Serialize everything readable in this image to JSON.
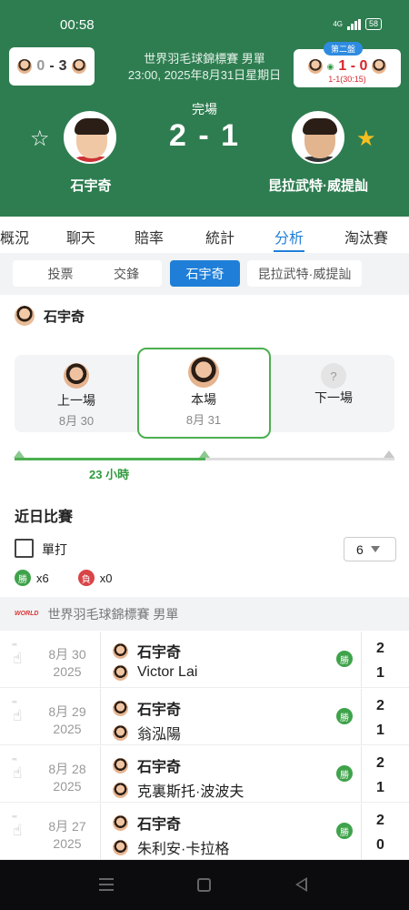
{
  "status_bar": {
    "time": "00:58",
    "network": "4G",
    "battery": "58"
  },
  "header": {
    "tournament": "世界羽毛球錦標賽 男單",
    "datetime": "23:00, 2025年8月31日星期日",
    "status": "完場",
    "score": "2 - 1",
    "left_card": {
      "score_a": "0",
      "dash": "-",
      "score_b": "3"
    },
    "right_card": {
      "set_label": "第二盤",
      "score": "1 - 0",
      "sub": "1-1(30:15)"
    },
    "player_left": "石宇奇",
    "player_right": "昆拉武特·威提訕",
    "accent": "#2e7d50"
  },
  "tabs": [
    "概況",
    "聊天",
    "賠率",
    "統計",
    "分析",
    "淘汰賽"
  ],
  "active_tab": "分析",
  "subtabs": [
    "投票",
    "交鋒",
    "石宇奇",
    "昆拉武特·威提訕"
  ],
  "active_subtab": "石宇奇",
  "player_section": {
    "name": "石宇奇",
    "timeline": [
      {
        "label": "上一場",
        "date": "8月 30"
      },
      {
        "label": "本場",
        "date": "8月 31"
      },
      {
        "label": "下一場",
        "date": ""
      }
    ],
    "gap": "23 小時"
  },
  "recent": {
    "title": "近日比賽",
    "filter_label": "單打",
    "count_select": "6",
    "wins_badge": "勝",
    "wins": "x6",
    "losses_badge": "負",
    "losses": "x0",
    "league": "世界羽毛球錦標賽 男單",
    "league_logo": "WORLD",
    "matches": [
      {
        "date": "8月 30",
        "year": "2025",
        "p1": "石宇奇",
        "p2": "Victor Lai",
        "result": "勝",
        "s1": "2",
        "s2": "1"
      },
      {
        "date": "8月 29",
        "year": "2025",
        "p1": "石宇奇",
        "p2": "翁泓陽",
        "result": "勝",
        "s1": "2",
        "s2": "1"
      },
      {
        "date": "8月 28",
        "year": "2025",
        "p1": "石宇奇",
        "p2": "克裏斯托·波波夫",
        "result": "勝",
        "s1": "2",
        "s2": "1"
      },
      {
        "date": "8月 27",
        "year": "2025",
        "p1": "石宇奇",
        "p2": "朱利安·卡拉格",
        "result": "勝",
        "s1": "2",
        "s2": "0"
      }
    ]
  }
}
